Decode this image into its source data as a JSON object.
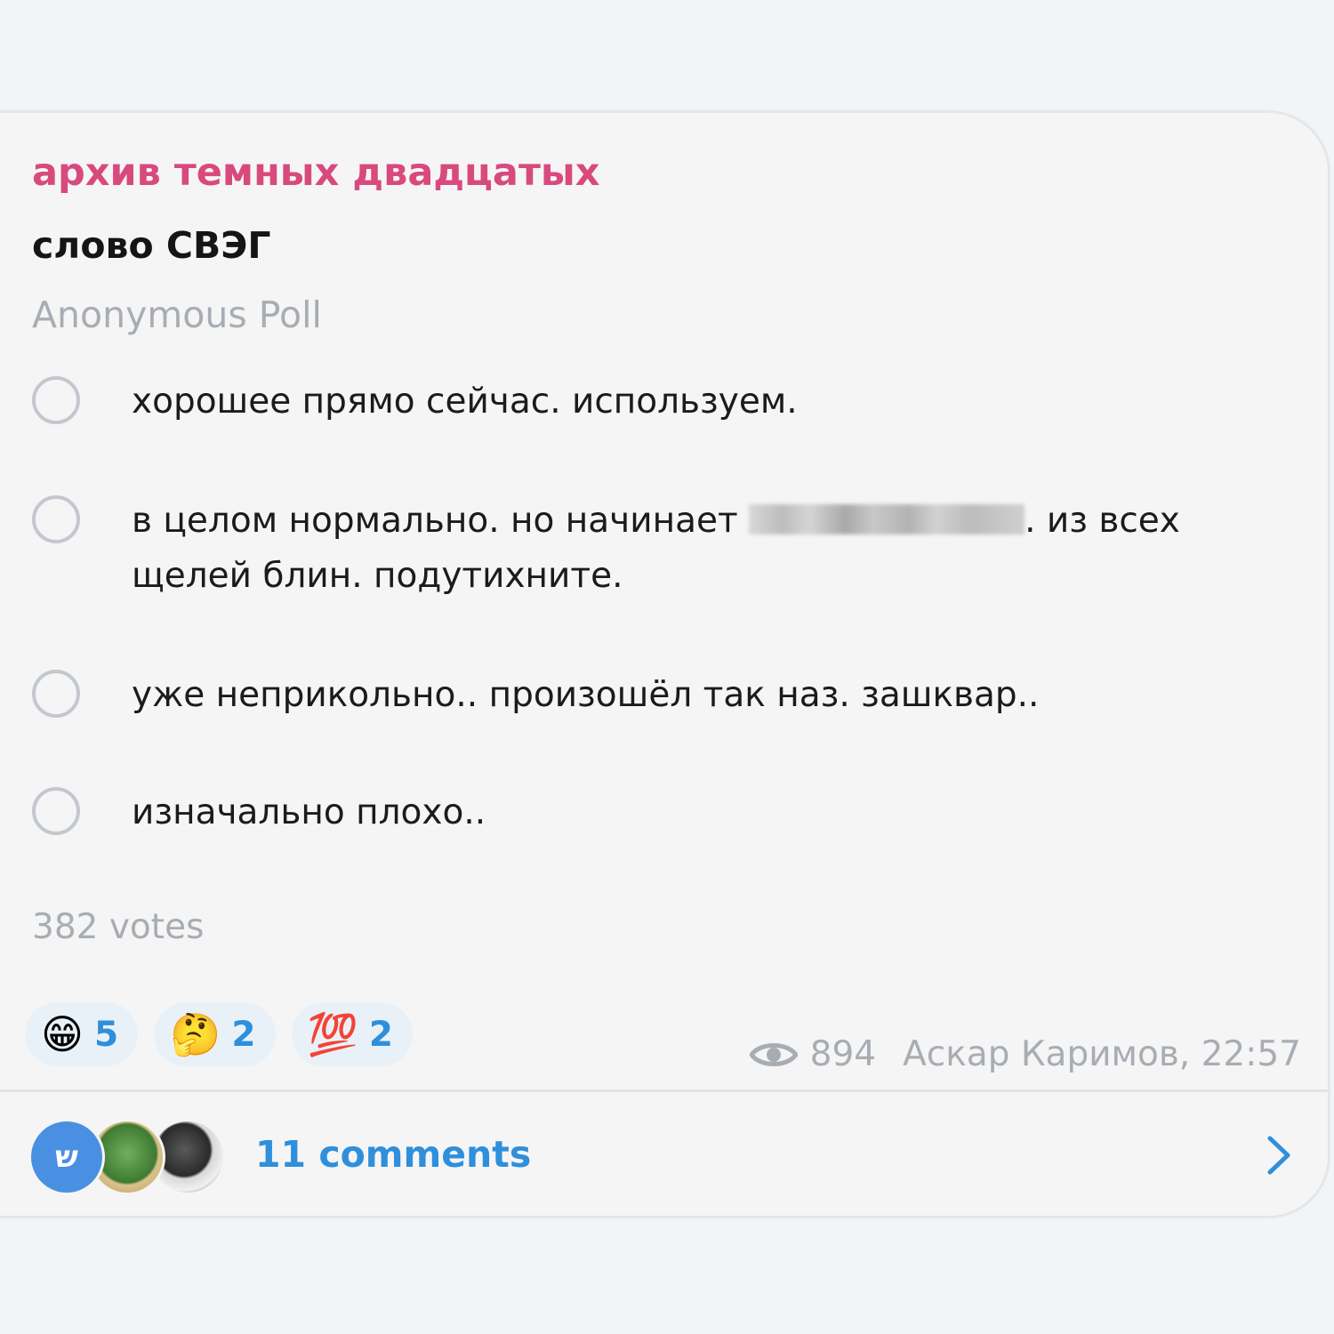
{
  "channel": {
    "name": "архив темных двадцатых"
  },
  "poll": {
    "question": "слово СВЭГ",
    "type_label": "Anonymous Poll",
    "options": [
      {
        "text": "хорошее прямо сейчас. используем."
      },
      {
        "text_before": "в целом нормально. но начинает",
        "text_after": ". из всех щелей блин. подутихните."
      },
      {
        "text": "уже неприкольно.. произошёл так наз. зашквар.."
      },
      {
        "text": "изначально плохо.."
      }
    ],
    "votes_label": "382 votes"
  },
  "reactions": [
    {
      "emoji": "😁",
      "icon": "grinning-face-icon",
      "count": "5"
    },
    {
      "emoji": "🤔",
      "icon": "thinking-face-icon",
      "count": "2"
    },
    {
      "emoji": "💯",
      "icon": "hundred-points-icon",
      "count": "2"
    }
  ],
  "meta": {
    "views": "894",
    "author_time": "Аскар Каримов, 22:57"
  },
  "comments": {
    "label": "11 comments",
    "avatar_1_text": "ש"
  },
  "colors": {
    "channel_name": "#d84a7d",
    "accent": "#2f8fdb",
    "muted": "#a8adb3",
    "background": "#f5f5f5"
  }
}
